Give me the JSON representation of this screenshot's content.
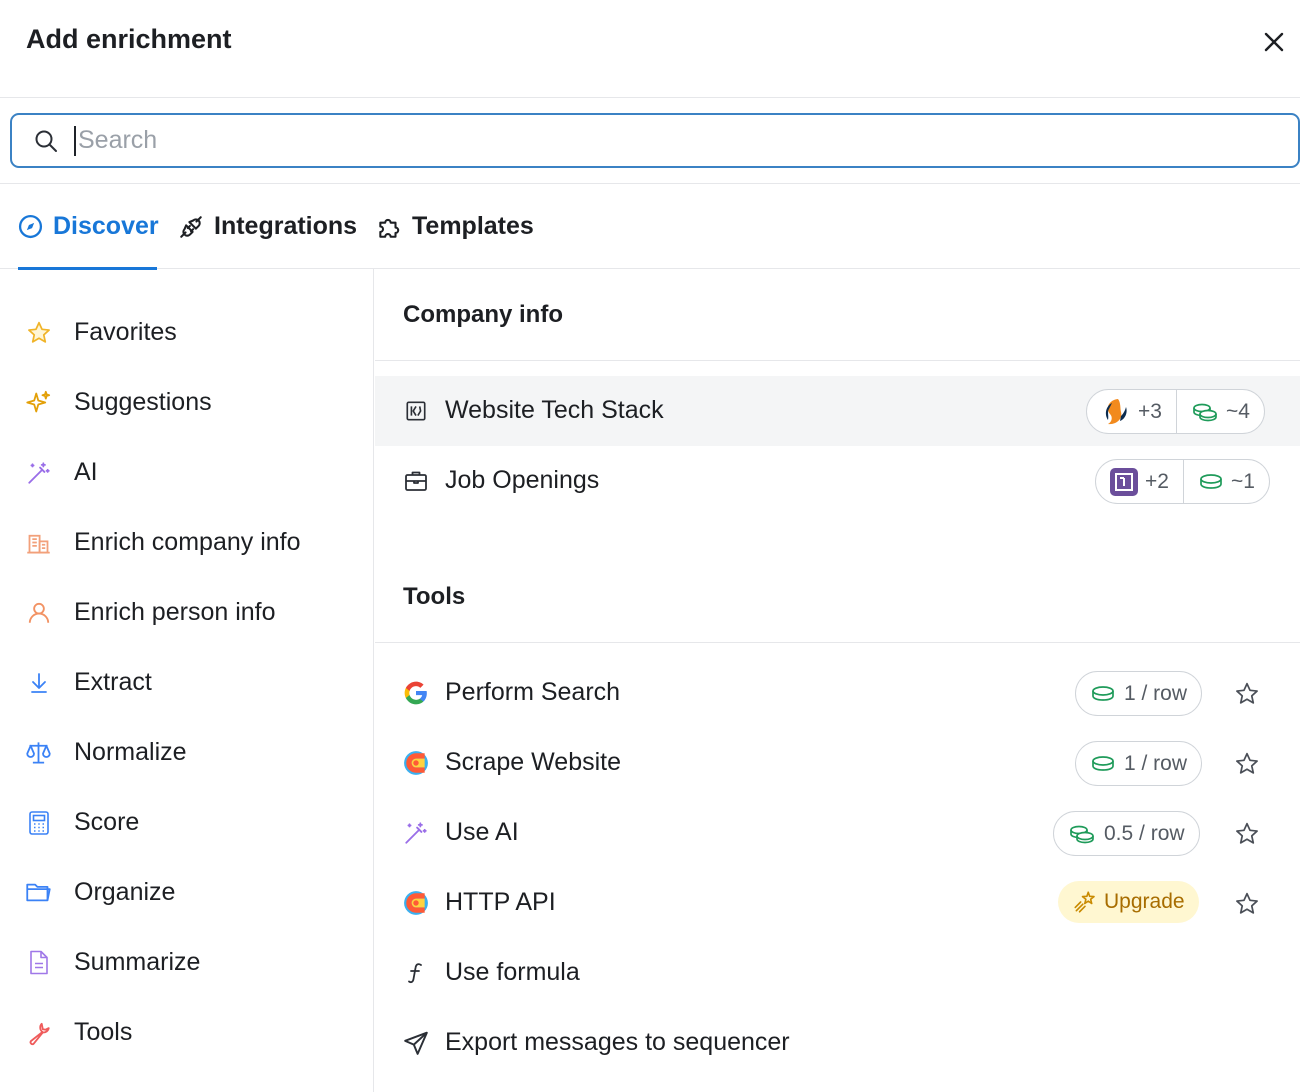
{
  "header": {
    "title": "Add enrichment"
  },
  "search": {
    "placeholder": "Search",
    "value": ""
  },
  "tabs": [
    {
      "label": "Discover",
      "icon": "compass-icon",
      "active": true
    },
    {
      "label": "Integrations",
      "icon": "plug-icon",
      "active": false
    },
    {
      "label": "Templates",
      "icon": "puzzle-icon",
      "active": false
    }
  ],
  "sidebar": {
    "items": [
      {
        "label": "Favorites",
        "icon": "star-icon"
      },
      {
        "label": "Suggestions",
        "icon": "sparkles-icon"
      },
      {
        "label": "AI",
        "icon": "magic-wand-icon"
      },
      {
        "label": "Enrich company info",
        "icon": "building-icon"
      },
      {
        "label": "Enrich person info",
        "icon": "person-icon"
      },
      {
        "label": "Extract",
        "icon": "arrow-down-icon"
      },
      {
        "label": "Normalize",
        "icon": "scale-icon"
      },
      {
        "label": "Score",
        "icon": "calculator-icon"
      },
      {
        "label": "Organize",
        "icon": "folder-icon"
      },
      {
        "label": "Summarize",
        "icon": "document-icon"
      },
      {
        "label": "Tools",
        "icon": "wrench-icon"
      }
    ]
  },
  "sections": {
    "company": {
      "title": "Company info",
      "rows": [
        {
          "label": "Website Tech Stack",
          "icon": "tech-stack-icon",
          "providers_extra": "+3",
          "credits": "~4"
        },
        {
          "label": "Job Openings",
          "icon": "briefcase-icon",
          "providers_extra": "+2",
          "credits": "~1"
        }
      ]
    },
    "tools": {
      "title": "Tools",
      "rows": [
        {
          "label": "Perform Search",
          "icon": "google-icon",
          "cost": "1 / row"
        },
        {
          "label": "Scrape Website",
          "icon": "clay-icon",
          "cost": "1 / row"
        },
        {
          "label": "Use AI",
          "icon": "magic-wand-icon",
          "cost": "0.5 / row"
        },
        {
          "label": "HTTP API",
          "icon": "clay-icon",
          "badge": "Upgrade"
        },
        {
          "label": "Use formula",
          "icon": "function-icon"
        },
        {
          "label": "Export messages to sequencer",
          "icon": "send-icon"
        }
      ]
    }
  },
  "colors": {
    "accent": "#1877d8",
    "credit_green": "#1f9b5a",
    "upgrade_text": "#a86d00",
    "upgrade_bg": "#fff7d1"
  }
}
